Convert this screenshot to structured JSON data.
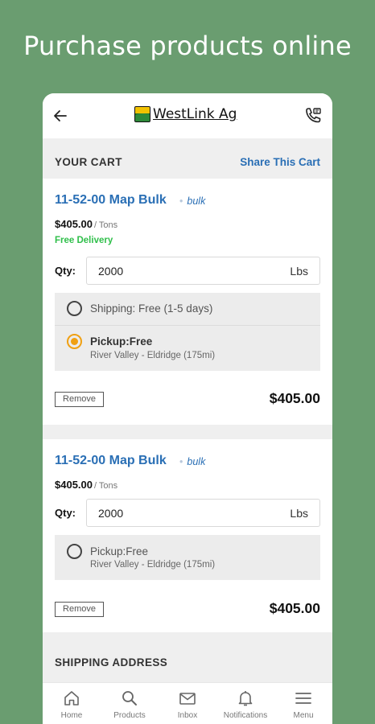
{
  "promo": {
    "title": "Purchase products online"
  },
  "header": {
    "logo_text": "WestLink Ag",
    "back_icon": "back-arrow-icon",
    "phone_icon": "phone-call-icon"
  },
  "cart": {
    "title": "YOUR CART",
    "share_label": "Share This Cart"
  },
  "items": [
    {
      "name": "11-52-00 Map Bulk",
      "tag": "bulk",
      "price": "$405.00",
      "unit": "/ Tons",
      "delivery": "Free Delivery",
      "qty_label": "Qty:",
      "qty_value": "2000",
      "qty_unit": "Lbs",
      "options": [
        {
          "label": "Shipping: Free (1-5 days)",
          "sub": "",
          "selected": false
        },
        {
          "label": "Pickup:Free",
          "sub": "River Valley - Eldridge (175mi)",
          "selected": true
        }
      ],
      "remove_label": "Remove",
      "total": "$405.00"
    },
    {
      "name": "11-52-00 Map Bulk",
      "tag": "bulk",
      "price": "$405.00",
      "unit": "/ Tons",
      "qty_label": "Qty:",
      "qty_value": "2000",
      "qty_unit": "Lbs",
      "options": [
        {
          "label": "Pickup:Free",
          "sub": "River Valley - Eldridge (175mi)",
          "selected": false
        }
      ],
      "remove_label": "Remove",
      "total": "$405.00"
    }
  ],
  "shipping": {
    "title": "SHIPPING ADDRESS"
  },
  "nav": [
    {
      "label": "Home",
      "icon": "home-icon"
    },
    {
      "label": "Products",
      "icon": "search-icon"
    },
    {
      "label": "Inbox",
      "icon": "mail-icon"
    },
    {
      "label": "Notifications",
      "icon": "bell-icon"
    },
    {
      "label": "Menu",
      "icon": "menu-icon"
    }
  ],
  "colors": {
    "background": "#6a9d70",
    "link": "#2a6fb5",
    "free": "#2fbf4a",
    "radio_selected": "#f0a012"
  }
}
